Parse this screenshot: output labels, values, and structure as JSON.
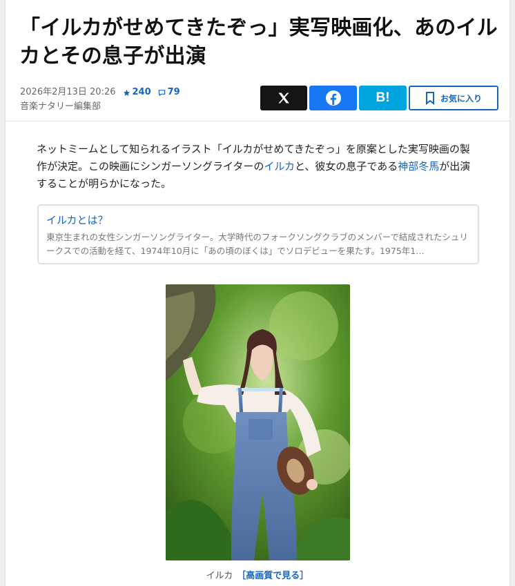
{
  "article": {
    "title": "「イルカがせめてきたぞっ」実写映画化、あのイルカとその息子が出演",
    "date": "2026年2月13日 20:26",
    "stars": "240",
    "comments": "79",
    "author": "音楽ナタリー編集部"
  },
  "share": {
    "hatena_label": "B!",
    "favorite_label": "お気に入り"
  },
  "lead": {
    "part1": "ネットミームとして知られるイラスト「イルカがせめてきたぞっ」を原案とした実写映画の製作が決定。この映画にシンガーソングライターの",
    "link1": "イルカ",
    "part2": "と、彼女の息子である",
    "link2": "神部冬馬",
    "part3": "が出演することが明らかになった。"
  },
  "info_card": {
    "title": "イルカとは？",
    "body": "東京生まれの女性シンガーソングライター。大学時代のフォークソングクラブのメンバーで結成されたシュリークスでの活動を経て、1974年10月に「あの頃のぼくは」でソロデビューを果たす。1975年1…"
  },
  "photo": {
    "caption": "イルカ",
    "hq_link": "［高画質で見る］"
  },
  "colors": {
    "accent": "#1565c0",
    "x": "#151515",
    "facebook": "#1877f2",
    "hatena": "#00a4de"
  },
  "icons": [
    "star-icon",
    "comment-icon",
    "x-logo-icon",
    "facebook-icon",
    "bookmark-icon"
  ]
}
